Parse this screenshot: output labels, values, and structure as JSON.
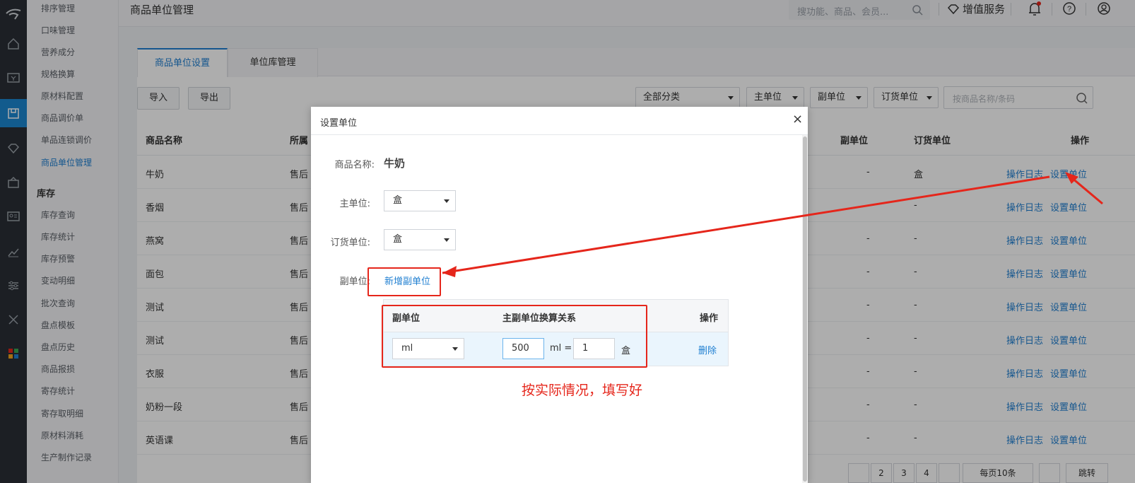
{
  "colors": {
    "accent": "#1f7fd1",
    "annotation": "#e5261b",
    "sidebar_dark": "#2a2f35"
  },
  "icon_bar": {
    "icons": [
      "logo-icon",
      "home-icon",
      "cashier-icon",
      "goods-icon",
      "diamond-icon",
      "marketing-icon",
      "member-card-icon",
      "report-icon",
      "settings-icon",
      "tools-icon",
      "apps-icon"
    ]
  },
  "submenu": {
    "items_top": [
      "排序管理",
      "口味管理",
      "营养成分",
      "规格换算",
      "原材料配置",
      "商品调价单",
      "单品连锁调价",
      "商品单位管理"
    ],
    "section": "库存",
    "items_stock": [
      "库存查询",
      "库存统计",
      "库存预警",
      "变动明细",
      "批次查询",
      "盘点模板",
      "盘点历史",
      "商品报损",
      "寄存统计",
      "寄存取明细",
      "原材料消耗",
      "生产制作记录"
    ]
  },
  "topbar": {
    "title": "商品单位管理",
    "search_placeholder": "搜功能、商品、会员...",
    "vip_label": "增值服务"
  },
  "tabs": [
    "商品单位设置",
    "单位库管理"
  ],
  "toolbar": {
    "import_label": "导入",
    "export_label": "导出",
    "filters": [
      "全部分类",
      "主单位",
      "副单位",
      "订货单位"
    ],
    "search_placeholder": "按商品名称/条码"
  },
  "table": {
    "headers": {
      "name": "商品名称",
      "category": "所属",
      "sub_unit": "副单位",
      "order_unit": "订货单位",
      "action": "操作"
    },
    "rows": [
      {
        "name": "牛奶",
        "category": "售后",
        "sub_unit": "-",
        "order_unit": "盒"
      },
      {
        "name": "香烟",
        "category": "售后",
        "sub_unit": "-",
        "order_unit": "-"
      },
      {
        "name": "燕窝",
        "category": "售后",
        "sub_unit": "-",
        "order_unit": "-"
      },
      {
        "name": "面包",
        "category": "售后",
        "sub_unit": "-",
        "order_unit": "-"
      },
      {
        "name": "测试",
        "category": "售后",
        "sub_unit": "-",
        "order_unit": "-"
      },
      {
        "name": "测试",
        "category": "售后",
        "sub_unit": "-",
        "order_unit": "-"
      },
      {
        "name": "衣服",
        "category": "售后",
        "sub_unit": "-",
        "order_unit": "-"
      },
      {
        "name": "奶粉一段",
        "category": "售后",
        "sub_unit": "-",
        "order_unit": "-"
      },
      {
        "name": "英语课",
        "category": "售后",
        "sub_unit": "-",
        "order_unit": "-"
      }
    ],
    "action_log": "操作日志",
    "action_set": "设置单位"
  },
  "pager": {
    "p1": "2",
    "p2": "3",
    "p3": "4",
    "size": "每页10条",
    "jump": "跳转"
  },
  "modal": {
    "title": "设置单位",
    "close": "×",
    "name_label": "商品名称:",
    "name_value": "牛奶",
    "main_unit_label": "主单位:",
    "main_unit_value": "盒",
    "order_unit_label": "订货单位:",
    "order_unit_value": "盒",
    "sub_unit_label": "副单位:",
    "add_sub_unit": "新增副单位",
    "sub_table": {
      "headers": {
        "sub_unit": "副单位",
        "relation": "主副单位换算关系",
        "action": "操作"
      },
      "row": {
        "unit": "ml",
        "amount": "500",
        "equals": "ml =",
        "main_amount": "1",
        "main_unit": "盒",
        "delete": "删除"
      }
    }
  },
  "annotation": {
    "hint": "按实际情况，填写好"
  }
}
